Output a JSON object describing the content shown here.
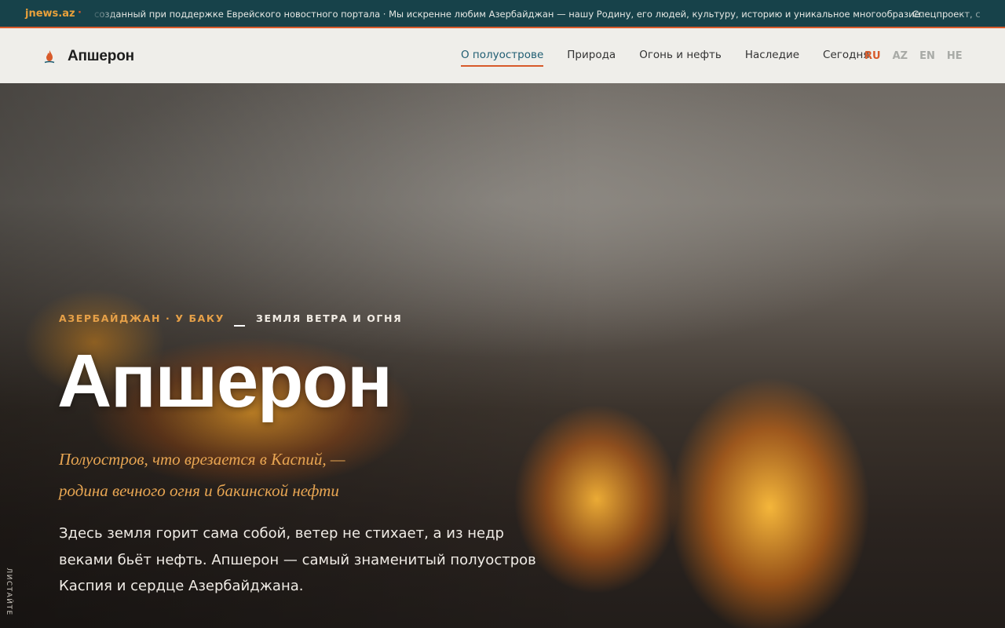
{
  "ticker": {
    "brand": "jnews.az",
    "separator": "·",
    "text": "созданный при поддержке Еврейского новостного портала · Мы искренне любим Азербайджан — нашу Родину, его людей, культуру, историю и уникальное многообразие.",
    "text_continued": "Спецпроект, с"
  },
  "header": {
    "logo_title": "Апшерон",
    "logo_icon": "flame-icon",
    "nav": [
      {
        "label": "О полуострове",
        "active": true
      },
      {
        "label": "Природа",
        "active": false
      },
      {
        "label": "Огонь и нефть",
        "active": false
      },
      {
        "label": "Наследие",
        "active": false
      },
      {
        "label": "Сегодня",
        "active": false
      }
    ],
    "languages": [
      {
        "label": "RU",
        "active": true
      },
      {
        "label": "AZ",
        "active": false
      },
      {
        "label": "EN",
        "active": false
      },
      {
        "label": "HE",
        "active": false
      }
    ]
  },
  "hero": {
    "kicker_1": "АЗЕРБАЙДЖАН · У БАКУ",
    "kicker_2": "ЗЕМЛЯ ВЕТРА И ОГНЯ",
    "title": "Апшерон",
    "subtitle_line1": "Полуостров, что врезается в Каспий, —",
    "subtitle_line2": "родина вечного огня и бакинской нефти",
    "lead": "Здесь земля горит сама собой, ветер не стихает, а из недр веками бьёт нефть. Апшерон — самый знаменитый полуостров Каспия и сердце Азербайджана.",
    "scroll_hint": "ЛИСТАЙТЕ"
  },
  "colors": {
    "accent": "#d85a2a",
    "ticker_bg": "#17424a",
    "header_bg": "#efeeea",
    "nav_active": "#1f5d72",
    "kicker": "#e6a048",
    "subtitle": "#e7a552"
  }
}
